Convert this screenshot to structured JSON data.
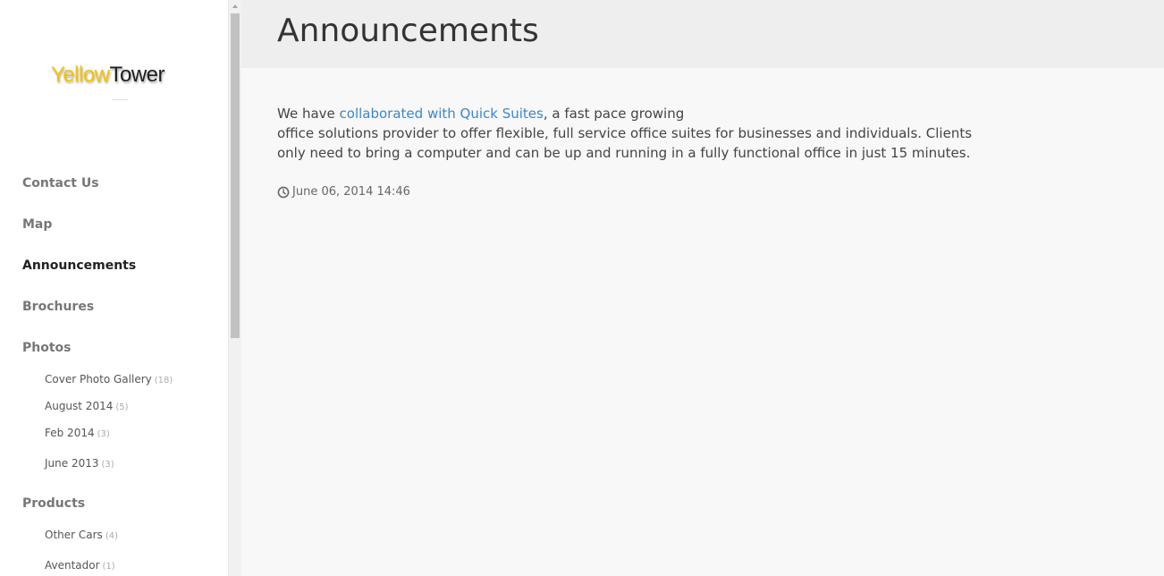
{
  "brand": {
    "part1": "Yellow",
    "part2": "Tower"
  },
  "sidebar": {
    "items": [
      {
        "label": "Contact Us"
      },
      {
        "label": "Map"
      },
      {
        "label": "Announcements"
      },
      {
        "label": "Brochures"
      },
      {
        "label": "Photos"
      },
      {
        "label": "Products"
      }
    ],
    "photos_sub": [
      {
        "label": "Cover Photo Gallery",
        "count": "(18)"
      },
      {
        "label": "August 2014",
        "count": "(5)"
      },
      {
        "label": "Feb 2014",
        "count": "(3)"
      },
      {
        "label": "June 2013",
        "count": "(3)"
      }
    ],
    "products_sub": [
      {
        "label": "Other Cars",
        "count": "(4)"
      },
      {
        "label": "Aventador",
        "count": "(1)"
      }
    ]
  },
  "header": {
    "title": "Announcements"
  },
  "post": {
    "text_before": "We have ",
    "link_text": "collaborated with Quick Suites",
    "text_line1_after": ", a fast pace growing",
    "text_rest": "office solutions provider to offer flexible, full service office suites for businesses and individuals. Clients only need to bring a computer and can be up and running in a fully functional office in just 15 minutes.",
    "date": "June 06, 2014 14:46"
  },
  "colors": {
    "link": "#3a87c8",
    "brand_yellow": "#f5c400",
    "header_bg": "#eeeeee",
    "content_bg": "#f8f8f8"
  }
}
